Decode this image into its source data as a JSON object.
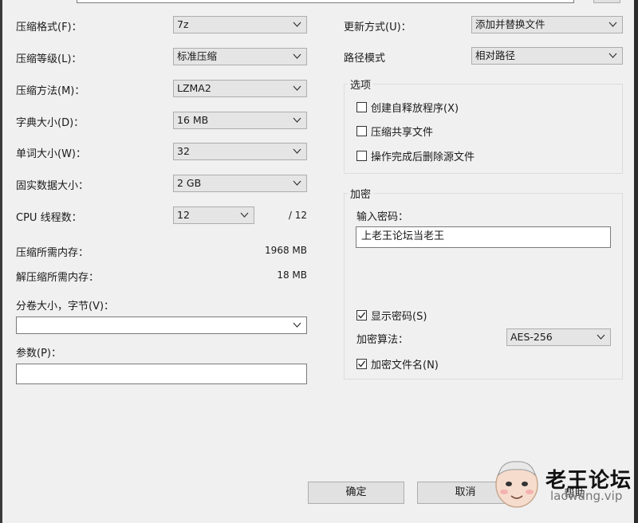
{
  "left": {
    "format_label": "压缩格式(F)：",
    "format_value": "7z",
    "level_label": "压缩等级(L)：",
    "level_value": "标准压缩",
    "method_label": "压缩方法(M)：",
    "method_value": "LZMA2",
    "dict_label": "字典大小(D)：",
    "dict_value": "16 MB",
    "word_label": "单词大小(W)：",
    "word_value": "32",
    "solid_label": "固实数据大小：",
    "solid_value": "2 GB",
    "threads_label": "CPU 线程数：",
    "threads_value": "12",
    "threads_max": "/ 12",
    "mem_comp_label": "压缩所需内存：",
    "mem_comp_value": "1968 MB",
    "mem_decomp_label": "解压缩所需内存：",
    "mem_decomp_value": "18 MB",
    "volume_label": "分卷大小，字节(V)：",
    "volume_value": "",
    "params_label": "参数(P)：",
    "params_value": ""
  },
  "right": {
    "update_label": "更新方式(U)：",
    "update_value": "添加并替换文件",
    "path_label": "路径模式",
    "path_value": "相对路径",
    "options_title": "选项",
    "opt_sfx": "创建自释放程序(X)",
    "opt_shared": "压缩共享文件",
    "opt_delete": "操作完成后删除源文件",
    "encryption_title": "加密",
    "password_label": "输入密码：",
    "password_value": "上老王论坛当老王",
    "show_password": "显示密码(S)",
    "enc_method_label": "加密算法：",
    "enc_method_value": "AES-256",
    "encrypt_names": "加密文件名(N)"
  },
  "buttons": {
    "ok": "确定",
    "cancel": "取消",
    "help": "帮助"
  },
  "watermark": {
    "title": "老王论坛",
    "url": "laowang.vip"
  },
  "checks": {
    "sfx": false,
    "shared": false,
    "delete": false,
    "show_password": true,
    "encrypt_names": true
  }
}
